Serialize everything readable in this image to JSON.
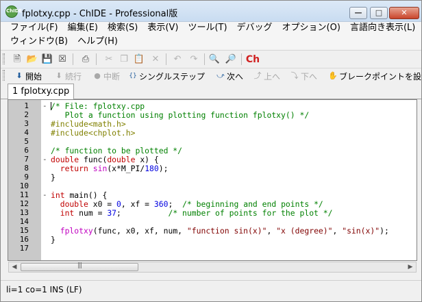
{
  "window": {
    "title": "fplotxy.cpp - ChIDE - Professional版",
    "app_icon_text": "ChIDE",
    "minimize_glyph": "—",
    "maximize_glyph": "□",
    "close_glyph": "✕"
  },
  "menubar": {
    "row1": [
      "ファイル(F)",
      "編集(E)",
      "検索(S)",
      "表示(V)",
      "ツール(T)",
      "デバッグ",
      "オプション(O)",
      "言語向き表示(L)"
    ],
    "row2": [
      "ウィンドウ(B)",
      "ヘルプ(H)"
    ]
  },
  "toolbar": {
    "ch_label": "Ch"
  },
  "debug_toolbar": {
    "start": "開始",
    "continue": "続行",
    "break": "中断",
    "single_step": "シングルステップ",
    "next": "次へ",
    "up": "上へ",
    "down": "下へ",
    "breakpoint": "ブレークポイントを設"
  },
  "tab": {
    "label": "1 fplotxy.cpp"
  },
  "editor": {
    "line_numbers": [
      "1",
      "2",
      "3",
      "4",
      "5",
      "6",
      "7",
      "8",
      "9",
      "10",
      "11",
      "12",
      "13",
      "14",
      "15",
      "16",
      "17"
    ],
    "fold_markers": {
      "1": "-",
      "7": "-",
      "11": "-"
    },
    "lines": [
      [
        {
          "t": "/* File: fplotxy.cpp",
          "c": "com"
        }
      ],
      [
        {
          "t": "   Plot a function using plotting function fplotxy() */",
          "c": "com"
        }
      ],
      [
        {
          "t": "#include<math.h>",
          "c": "pp"
        }
      ],
      [
        {
          "t": "#include<chplot.h>",
          "c": "pp"
        }
      ],
      [],
      [
        {
          "t": "/* function to be plotted */",
          "c": "com"
        }
      ],
      [
        {
          "t": "double ",
          "c": "kw"
        },
        {
          "t": "func(",
          "c": "id"
        },
        {
          "t": "double ",
          "c": "kw"
        },
        {
          "t": "x) {",
          "c": "id"
        }
      ],
      [
        {
          "t": "  ",
          "c": "id"
        },
        {
          "t": "return ",
          "c": "kw"
        },
        {
          "t": "sin",
          "c": "fn"
        },
        {
          "t": "(x*M_PI/",
          "c": "id"
        },
        {
          "t": "180",
          "c": "num"
        },
        {
          "t": ");",
          "c": "id"
        }
      ],
      [
        {
          "t": "}",
          "c": "id"
        }
      ],
      [],
      [
        {
          "t": "int ",
          "c": "kw"
        },
        {
          "t": "main() {",
          "c": "id"
        }
      ],
      [
        {
          "t": "  ",
          "c": "id"
        },
        {
          "t": "double ",
          "c": "kw"
        },
        {
          "t": "x0 = ",
          "c": "id"
        },
        {
          "t": "0",
          "c": "num"
        },
        {
          "t": ", xf = ",
          "c": "id"
        },
        {
          "t": "360",
          "c": "num"
        },
        {
          "t": ";  ",
          "c": "id"
        },
        {
          "t": "/* beginning and end points */",
          "c": "com"
        }
      ],
      [
        {
          "t": "  ",
          "c": "id"
        },
        {
          "t": "int ",
          "c": "kw"
        },
        {
          "t": "num = ",
          "c": "id"
        },
        {
          "t": "37",
          "c": "num"
        },
        {
          "t": ";          ",
          "c": "id"
        },
        {
          "t": "/* number of points for the plot */",
          "c": "com"
        }
      ],
      [],
      [
        {
          "t": "  ",
          "c": "id"
        },
        {
          "t": "fplotxy",
          "c": "fn"
        },
        {
          "t": "(func, x0, xf, num, ",
          "c": "id"
        },
        {
          "t": "\"function sin(x)\"",
          "c": "str"
        },
        {
          "t": ", ",
          "c": "id"
        },
        {
          "t": "\"x (degree)\"",
          "c": "str"
        },
        {
          "t": ", ",
          "c": "id"
        },
        {
          "t": "\"sin(x)\"",
          "c": "str"
        },
        {
          "t": ");",
          "c": "id"
        }
      ],
      [
        {
          "t": "}",
          "c": "id"
        }
      ],
      []
    ]
  },
  "scrollbar": {
    "thumb_grip": "|||"
  },
  "statusbar": {
    "text": "li=1 co=1 INS (LF)"
  }
}
